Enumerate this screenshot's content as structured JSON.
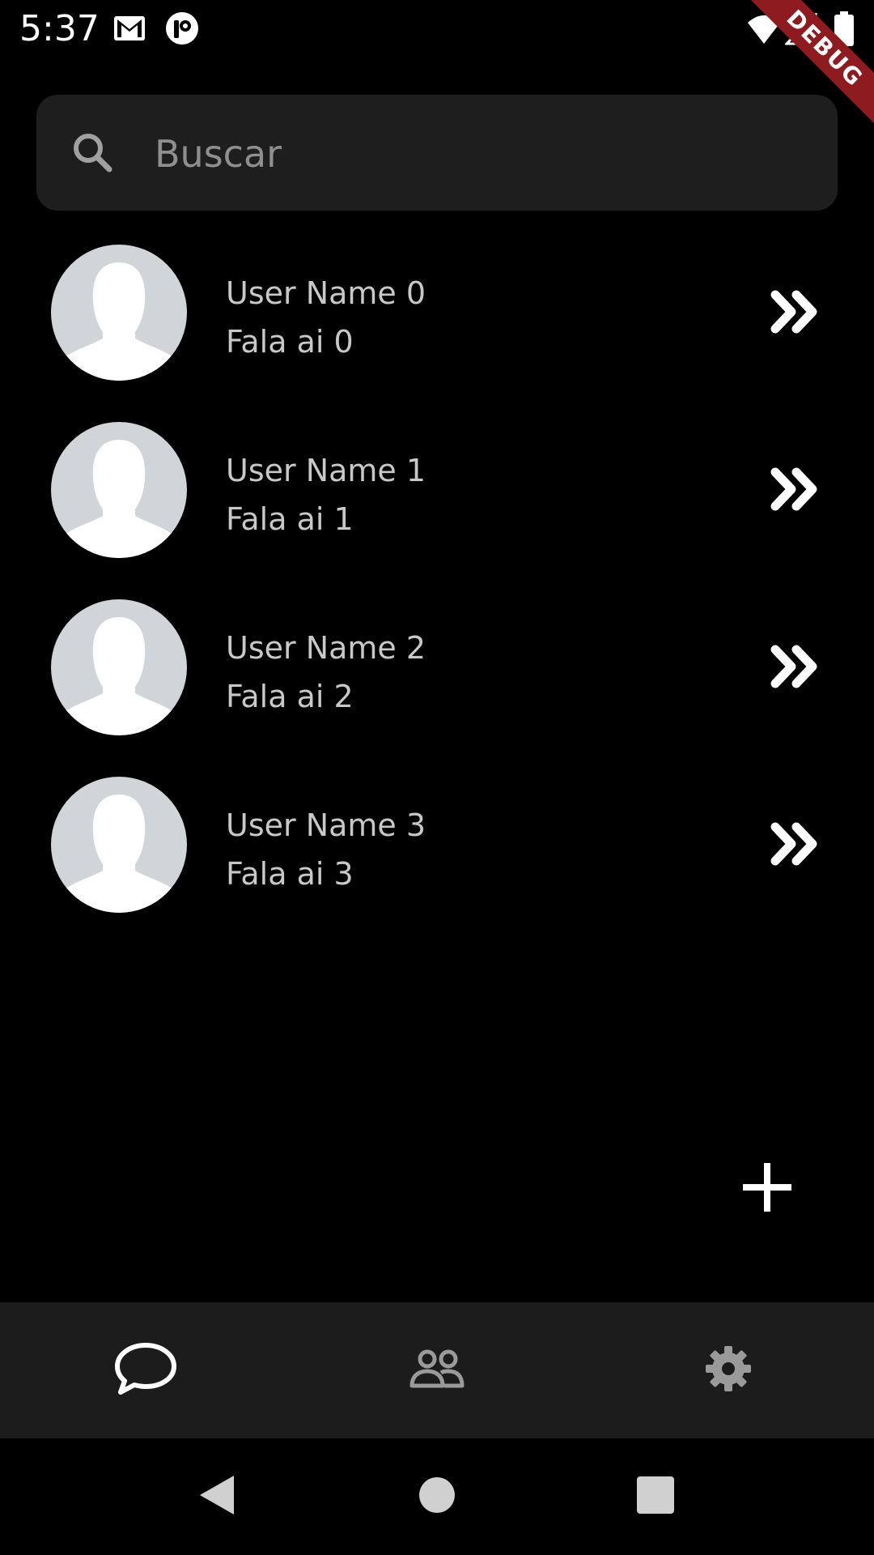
{
  "status_bar": {
    "time": "5:37",
    "icons": [
      "gmail-icon",
      "app-notification-icon",
      "wifi-icon",
      "signal-icon",
      "battery-icon"
    ]
  },
  "debug_banner": {
    "label": "DEBUG"
  },
  "search": {
    "placeholder": "Buscar",
    "value": ""
  },
  "chats": [
    {
      "name": "User Name 0",
      "message": "Fala ai 0"
    },
    {
      "name": "User Name 1",
      "message": "Fala ai 1"
    },
    {
      "name": "User Name 2",
      "message": "Fala ai 2"
    },
    {
      "name": "User Name 3",
      "message": "Fala ai 3"
    }
  ],
  "fab": {
    "icon": "plus-icon"
  },
  "bottom_nav": {
    "items": [
      {
        "id": "chats",
        "icon": "chat-bubble-icon",
        "active": true
      },
      {
        "id": "contacts",
        "icon": "people-icon",
        "active": false
      },
      {
        "id": "settings",
        "icon": "gear-icon",
        "active": false
      }
    ]
  },
  "system_nav": {
    "items": [
      "back-icon",
      "home-icon",
      "recents-icon"
    ]
  },
  "colors": {
    "background": "#000000",
    "surface": "#1e1e1e",
    "nav_background": "#1c1c1c",
    "text_secondary": "#c8c8c8",
    "placeholder": "#8f8f8f",
    "avatar_bg": "#d1d4d9",
    "debug_ribbon": "#8e1b1f"
  }
}
